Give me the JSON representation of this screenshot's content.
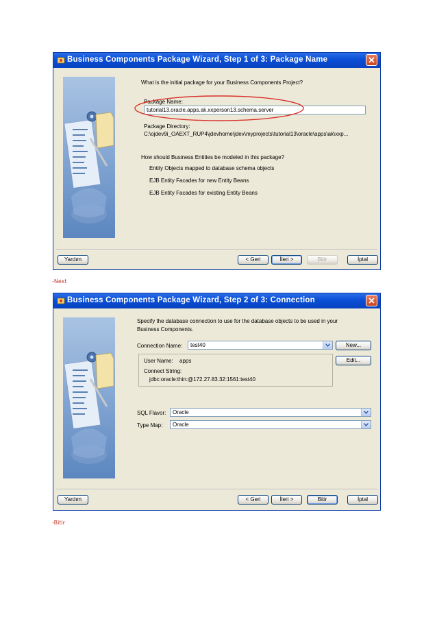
{
  "dialog1": {
    "title": "Business Components Package Wizard, Step 1 of 3: Package Name",
    "question": "What is the initial package for your Business Components Project?",
    "package_name_label": "Package Name:",
    "package_name_value": "tutorial13.oracle.apps.ak.xxperson13.schema.server",
    "package_dir_label": "Package Directory:",
    "package_dir_value": "C:\\ojdev9i_OAEXT_RUP4\\jdevhome\\jdev\\myprojects\\tutorial13\\oracle\\apps\\ak\\xxp...",
    "entities_question": "How should Business Entities be modeled in this package?",
    "options": [
      "Entity Objects mapped to database schema objects",
      "EJB Entity Facades for new Entity Beans",
      "EJB Entity Facades for existing Entity Beans"
    ],
    "buttons": {
      "help": "Yardım",
      "back": "< Geri",
      "next": "İleri >",
      "finish": "Bitir",
      "cancel": "İptal"
    }
  },
  "caption1": "-Next",
  "dialog2": {
    "title": "Business Components Package Wizard, Step 2 of 3: Connection",
    "intro_line1": "Specify the database connection to use for the database objects to be used in your",
    "intro_line2": "Business Components.",
    "connection_label": "Connection Name:",
    "connection_value": "test40",
    "new_button": "New...",
    "edit_button": "Edit...",
    "user_name_label": "User Name:",
    "user_name_value": "apps",
    "connect_string_label": "Connect String:",
    "connect_string_value": "jdbc:oracle:thin:@172.27.83.32:1561:test40",
    "sql_flavor_label": "SQL Flavor:",
    "sql_flavor_value": "Oracle",
    "type_map_label": "Type Map:",
    "type_map_value": "Oracle",
    "buttons": {
      "help": "Yardım",
      "back": "< Geri",
      "next": "İleri >",
      "finish": "Bitir",
      "cancel": "İptal"
    }
  },
  "caption2": "-Bitir",
  "colors": {
    "titlebar": "#0a4fd4",
    "dialog_bg": "#ece9d8",
    "highlight_ellipse": "#d9302a",
    "caption": "#c0392b"
  },
  "icons": [
    "wizard-app-icon",
    "close-icon",
    "chevron-down-icon",
    "gear-icon",
    "folder-icon"
  ]
}
